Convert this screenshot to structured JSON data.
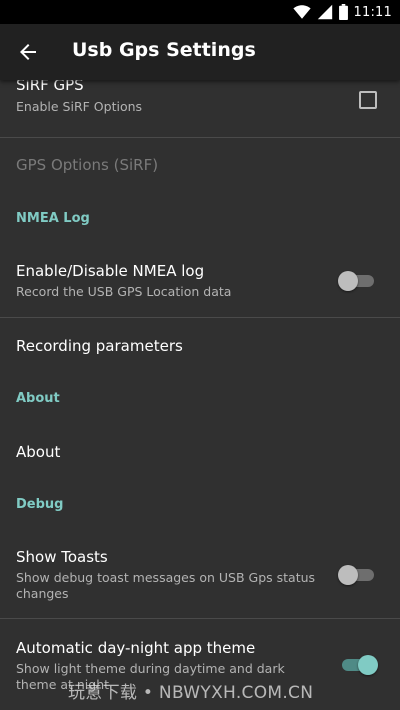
{
  "status_bar": {
    "time": "11:11"
  },
  "toolbar": {
    "title": "Usb Gps Settings",
    "back_icon": "arrow-back-icon"
  },
  "preferences": {
    "sirf_gps": {
      "title": "SiRF GPS",
      "summary": "Enable SiRF Options",
      "checked": false
    },
    "gps_options_sirf": {
      "title": "GPS Options (SiRF)",
      "enabled": false
    },
    "nmea_log_category": "NMEA Log",
    "enable_nmea_log": {
      "title": "Enable/Disable NMEA log",
      "summary": "Record the USB GPS Location data",
      "checked": false
    },
    "recording_parameters": {
      "title": "Recording parameters"
    },
    "about_category": "About",
    "about": {
      "title": "About"
    },
    "debug_category": "Debug",
    "show_toasts": {
      "title": "Show Toasts",
      "summary": "Show debug toast messages on USB Gps status changes",
      "checked": false
    },
    "day_night_theme": {
      "title": "Automatic day-night app theme",
      "summary": "Show light theme during daytime and dark theme at night",
      "checked": true
    }
  },
  "watermark": "玩意下载 • NBWYXH.COM.CN",
  "colors": {
    "background": "#303030",
    "toolbar": "#212121",
    "accent": "#80cbc4",
    "divider": "#4a4a4a"
  }
}
